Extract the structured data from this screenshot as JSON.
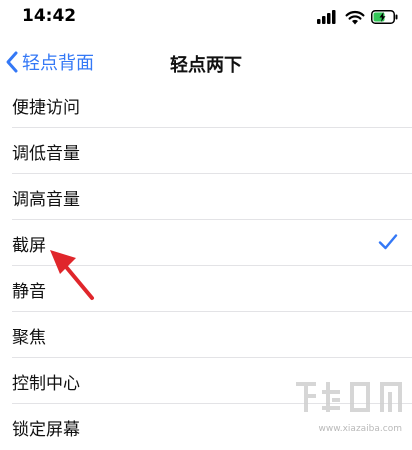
{
  "status_bar": {
    "time": "14:42"
  },
  "nav": {
    "back_label": "轻点背面",
    "title": "轻点两下"
  },
  "list": {
    "items": [
      {
        "label": "便捷访问",
        "selected": false
      },
      {
        "label": "调低音量",
        "selected": false
      },
      {
        "label": "调高音量",
        "selected": false
      },
      {
        "label": "截屏",
        "selected": true
      },
      {
        "label": "静音",
        "selected": false
      },
      {
        "label": "聚焦",
        "selected": false
      },
      {
        "label": "控制中心",
        "selected": false
      },
      {
        "label": "锁定屏幕",
        "selected": false
      }
    ]
  },
  "icons": {
    "signal": "cellular-signal-icon",
    "wifi": "wifi-icon",
    "battery": "battery-charging-icon",
    "back": "chevron-left-icon",
    "check": "checkmark-icon"
  },
  "colors": {
    "accent": "#3478f6",
    "annotation": "#e0262b",
    "battery_fill": "#34c759"
  },
  "watermark": {
    "domain": "www.xiazaiba.com"
  }
}
